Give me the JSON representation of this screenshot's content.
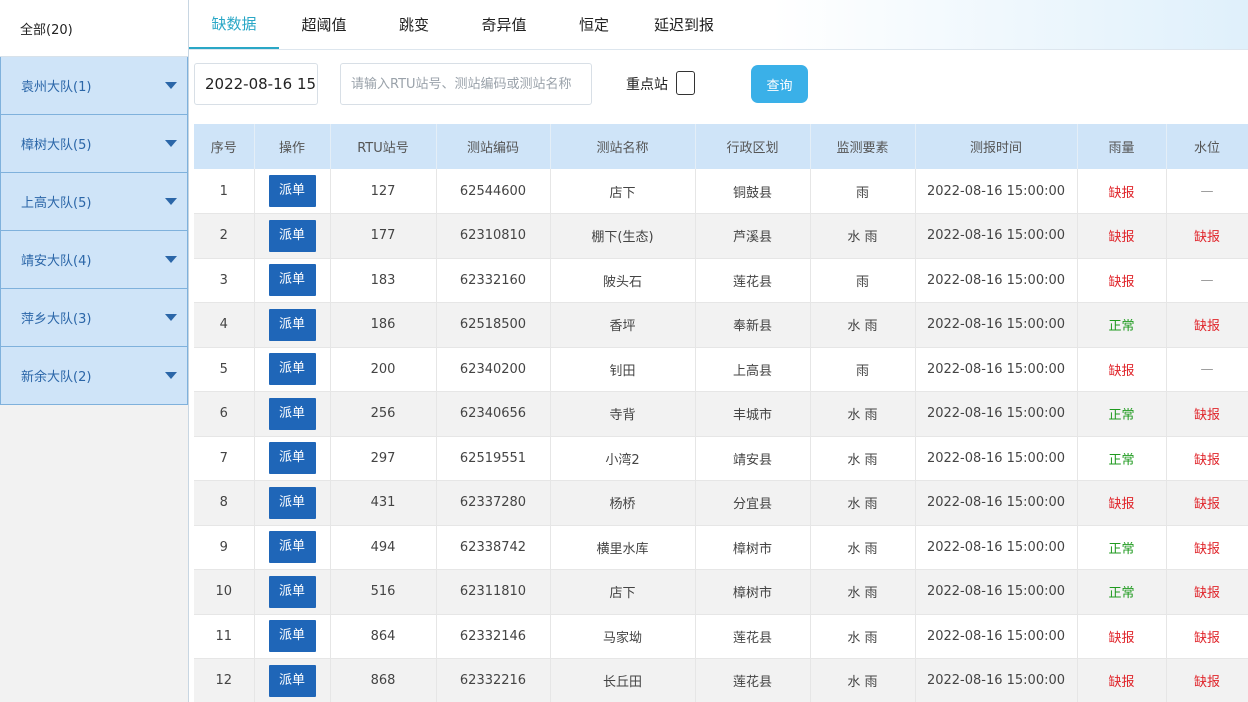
{
  "sidebar": {
    "all": "全部(20)",
    "groups": [
      {
        "label": "袁州大队(1)"
      },
      {
        "label": "樟树大队(5)"
      },
      {
        "label": "上高大队(5)"
      },
      {
        "label": "靖安大队(4)"
      },
      {
        "label": "萍乡大队(3)"
      },
      {
        "label": "新余大队(2)"
      }
    ]
  },
  "tabs": [
    {
      "label": "缺数据",
      "active": true
    },
    {
      "label": "超阈值"
    },
    {
      "label": "跳变"
    },
    {
      "label": "奇异值"
    },
    {
      "label": "恒定"
    },
    {
      "label": "延迟到报"
    }
  ],
  "filter": {
    "date_value": "2022-08-16 15",
    "search_placeholder": "请输入RTU站号、测站编码或测站名称",
    "key_station_label": "重点站",
    "query_label": "查询"
  },
  "colors": {
    "accent": "#2aa7c6",
    "button": "#1f66b8",
    "query": "#3ab0e8",
    "missing": "#e0252b",
    "normal": "#1f9a1f",
    "header_bg": "#cfe4f8"
  },
  "table": {
    "headers": [
      "序号",
      "操作",
      "RTU站号",
      "测站编码",
      "测站名称",
      "行政区划",
      "监测要素",
      "测报时间",
      "雨量",
      "水位"
    ],
    "action_label": "派单",
    "rows": [
      {
        "no": "1",
        "rtu": "127",
        "code": "62544600",
        "name": "店下",
        "region": "铜鼓县",
        "element": "雨",
        "time": "2022-08-16 15:00:00",
        "rain": "缺报",
        "water": "—"
      },
      {
        "no": "2",
        "rtu": "177",
        "code": "62310810",
        "name": "棚下(生态)",
        "region": "芦溪县",
        "element": "水 雨",
        "time": "2022-08-16 15:00:00",
        "rain": "缺报",
        "water": "缺报"
      },
      {
        "no": "3",
        "rtu": "183",
        "code": "62332160",
        "name": "陂头石",
        "region": "莲花县",
        "element": "雨",
        "time": "2022-08-16 15:00:00",
        "rain": "缺报",
        "water": "—"
      },
      {
        "no": "4",
        "rtu": "186",
        "code": "62518500",
        "name": "香坪",
        "region": "奉新县",
        "element": "水 雨",
        "time": "2022-08-16 15:00:00",
        "rain": "正常",
        "water": "缺报"
      },
      {
        "no": "5",
        "rtu": "200",
        "code": "62340200",
        "name": "钊田",
        "region": "上高县",
        "element": "雨",
        "time": "2022-08-16 15:00:00",
        "rain": "缺报",
        "water": "—"
      },
      {
        "no": "6",
        "rtu": "256",
        "code": "62340656",
        "name": "寺背",
        "region": "丰城市",
        "element": "水 雨",
        "time": "2022-08-16 15:00:00",
        "rain": "正常",
        "water": "缺报"
      },
      {
        "no": "7",
        "rtu": "297",
        "code": "62519551",
        "name": "小湾2",
        "region": "靖安县",
        "element": "水 雨",
        "time": "2022-08-16 15:00:00",
        "rain": "正常",
        "water": "缺报"
      },
      {
        "no": "8",
        "rtu": "431",
        "code": "62337280",
        "name": "杨桥",
        "region": "分宜县",
        "element": "水 雨",
        "time": "2022-08-16 15:00:00",
        "rain": "缺报",
        "water": "缺报"
      },
      {
        "no": "9",
        "rtu": "494",
        "code": "62338742",
        "name": "横里水库",
        "region": "樟树市",
        "element": "水 雨",
        "time": "2022-08-16 15:00:00",
        "rain": "正常",
        "water": "缺报"
      },
      {
        "no": "10",
        "rtu": "516",
        "code": "62311810",
        "name": "店下",
        "region": "樟树市",
        "element": "水 雨",
        "time": "2022-08-16 15:00:00",
        "rain": "正常",
        "water": "缺报"
      },
      {
        "no": "11",
        "rtu": "864",
        "code": "62332146",
        "name": "马家坳",
        "region": "莲花县",
        "element": "水 雨",
        "time": "2022-08-16 15:00:00",
        "rain": "缺报",
        "water": "缺报"
      },
      {
        "no": "12",
        "rtu": "868",
        "code": "62332216",
        "name": "长丘田",
        "region": "莲花县",
        "element": "水 雨",
        "time": "2022-08-16 15:00:00",
        "rain": "缺报",
        "water": "缺报"
      }
    ]
  }
}
